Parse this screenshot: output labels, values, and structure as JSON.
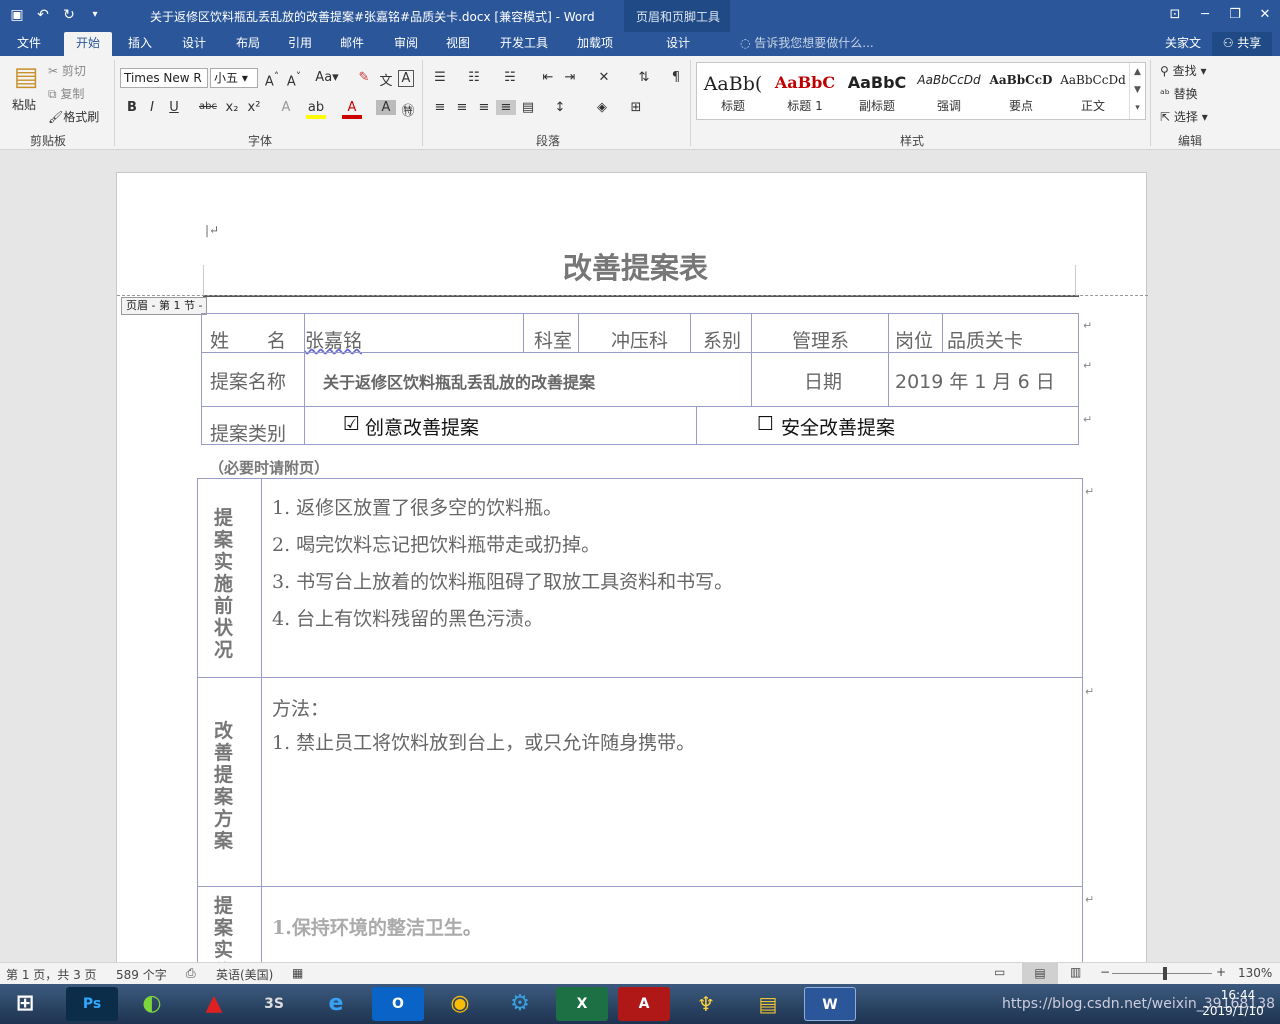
{
  "window": {
    "title": "关于返修区饮料瓶乱丢乱放的改善提案#张嘉铭#品质关卡.docx [兼容模式] - Word",
    "context_tool": "页眉和页脚工具"
  },
  "tabs": [
    "文件",
    "开始",
    "插入",
    "设计",
    "布局",
    "引用",
    "邮件",
    "审阅",
    "视图",
    "开发工具",
    "加载项",
    "设计"
  ],
  "tell_me": "告诉我您想要做什么...",
  "user": "关家文",
  "share": "共享",
  "clipboard": {
    "paste": "粘贴",
    "cut": "剪切",
    "copy": "复制",
    "format_painter": "格式刷",
    "label": "剪贴板"
  },
  "font": {
    "name": "Times New R",
    "size": "小五",
    "label": "字体"
  },
  "paragraph": {
    "label": "段落"
  },
  "styles": {
    "label": "样式",
    "items": [
      {
        "preview": "AaBb(",
        "name": "标题",
        "color": "#000"
      },
      {
        "preview": "AaBbC",
        "name": "标题 1",
        "color": "#c00000"
      },
      {
        "preview": "AaBbC",
        "name": "副标题",
        "color": "#000"
      },
      {
        "preview": "AaBbCcDd",
        "name": "强调",
        "color": "#333"
      },
      {
        "preview": "AaBbCcD",
        "name": "要点",
        "color": "#000"
      },
      {
        "preview": "AaBbCcDd",
        "name": "正文",
        "color": "#333"
      }
    ]
  },
  "editing": {
    "find": "查找",
    "replace": "替换",
    "select": "选择",
    "label": "编辑"
  },
  "doc": {
    "header_label": "页眉 - 第 1 节 -",
    "title": "改善提案表",
    "name_label": "姓　　名",
    "name_value": "张嘉铭",
    "dept_label": "科室",
    "dept_value": "冲压科",
    "system_label": "系别",
    "system_value": "管理系",
    "post_label": "岗位",
    "post_value": "品质关卡",
    "proposal_label": "提案名称",
    "proposal_value": "关于返修区饮料瓶乱丢乱放的改善提案",
    "date_label": "日期",
    "date_value": "2019 年 1  月 6  日",
    "type_label": "提案类别",
    "type_opt1": "创意改善提案",
    "type_opt2": "安全改善提案",
    "check1": "☑",
    "check2": "☐",
    "note": "（必要时请附页）",
    "sec1_label": "提案实施前状况",
    "sec1_items": [
      "1. 返修区放置了很多空的饮料瓶。",
      "2. 喝完饮料忘记把饮料瓶带走或扔掉。",
      "3. 书写台上放着的饮料瓶阻碍了取放工具资料和书写。",
      "4. 台上有饮料残留的黑色污渍。"
    ],
    "sec2_label": "改善提案方案",
    "sec2_method": "方法：",
    "sec2_items": [
      "1.   禁止员工将饮料放到台上，或只允许随身携带。"
    ],
    "sec3_label": "提案实施",
    "sec3_items": [
      "1.保持环境的整洁卫生。"
    ]
  },
  "status": {
    "page": "第 1 页，共 3 页",
    "words": "589 个字",
    "lang": "英语(美国)",
    "zoom": "130%"
  },
  "tray": {
    "time": "16:44",
    "date": "2019/1/10",
    "watermark": "https://blog.csdn.net/weixin_39168138"
  }
}
